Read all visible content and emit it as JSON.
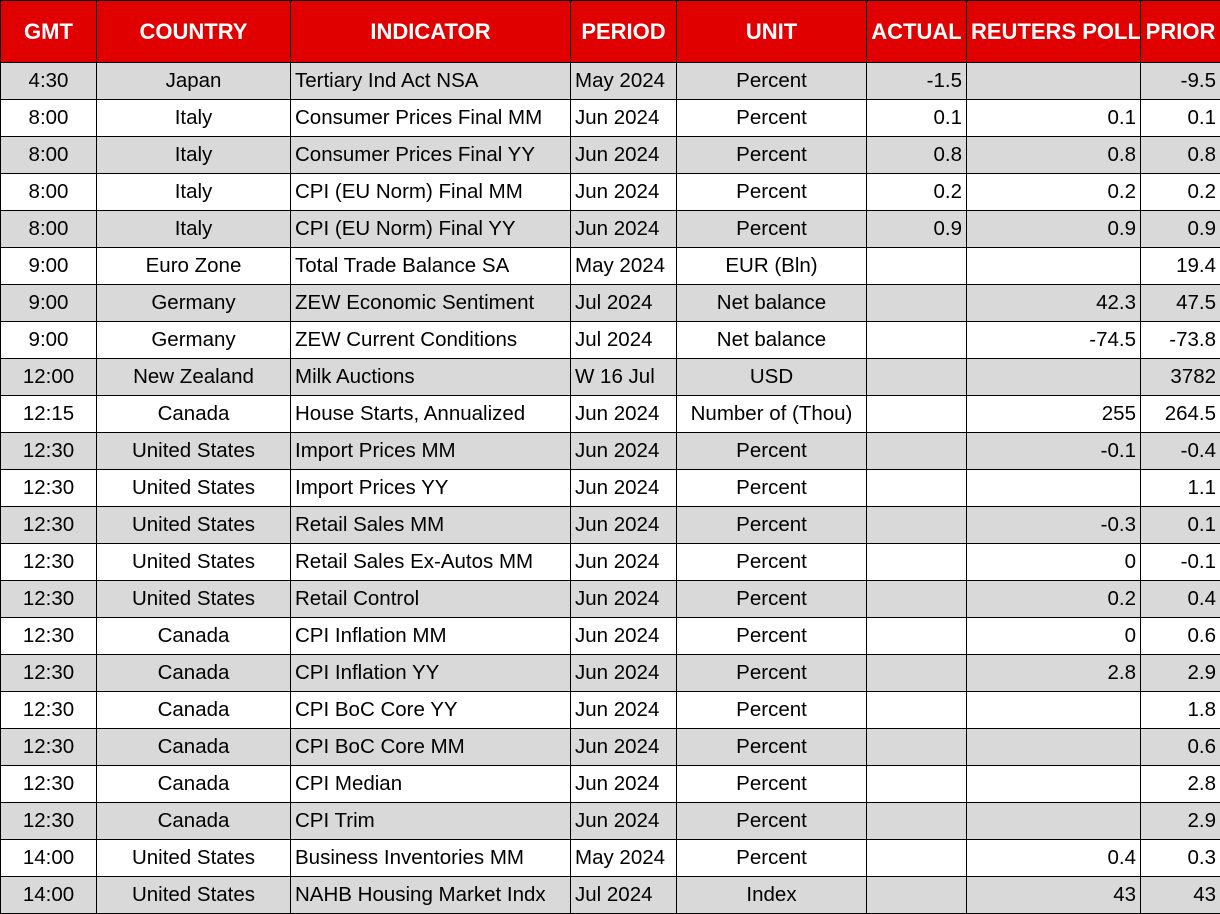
{
  "colors": {
    "header_bg": "#e00000",
    "header_text": "#ffffff",
    "stripe": "#d9d9d9"
  },
  "headers": [
    "GMT",
    "COUNTRY",
    "INDICATOR",
    "PERIOD",
    "UNIT",
    "ACTUAL",
    "REUTERS POLL",
    "PRIOR"
  ],
  "rows": [
    [
      "4:30",
      "Japan",
      "Tertiary Ind Act NSA",
      "May 2024",
      "Percent",
      "-1.5",
      "",
      "-9.5"
    ],
    [
      "8:00",
      "Italy",
      "Consumer Prices Final MM",
      "Jun 2024",
      "Percent",
      "0.1",
      "0.1",
      "0.1"
    ],
    [
      "8:00",
      "Italy",
      "Consumer Prices Final YY",
      "Jun 2024",
      "Percent",
      "0.8",
      "0.8",
      "0.8"
    ],
    [
      "8:00",
      "Italy",
      "CPI (EU Norm) Final MM",
      "Jun 2024",
      "Percent",
      "0.2",
      "0.2",
      "0.2"
    ],
    [
      "8:00",
      "Italy",
      "CPI (EU Norm) Final YY",
      "Jun 2024",
      "Percent",
      "0.9",
      "0.9",
      "0.9"
    ],
    [
      "9:00",
      "Euro Zone",
      "Total Trade Balance SA",
      "May 2024",
      "EUR (Bln)",
      "",
      "",
      "19.4"
    ],
    [
      "9:00",
      "Germany",
      "ZEW Economic Sentiment",
      "Jul 2024",
      "Net balance",
      "",
      "42.3",
      "47.5"
    ],
    [
      "9:00",
      "Germany",
      "ZEW Current Conditions",
      "Jul 2024",
      "Net balance",
      "",
      "-74.5",
      "-73.8"
    ],
    [
      "12:00",
      "New Zealand",
      "Milk Auctions",
      "W 16 Jul",
      "USD",
      "",
      "",
      "3782"
    ],
    [
      "12:15",
      "Canada",
      "House Starts, Annualized",
      "Jun 2024",
      "Number of (Thou)",
      "",
      "255",
      "264.5"
    ],
    [
      "12:30",
      "United States",
      "Import Prices MM",
      "Jun 2024",
      "Percent",
      "",
      "-0.1",
      "-0.4"
    ],
    [
      "12:30",
      "United States",
      "Import Prices YY",
      "Jun 2024",
      "Percent",
      "",
      "",
      "1.1"
    ],
    [
      "12:30",
      "United States",
      "Retail Sales MM",
      "Jun 2024",
      "Percent",
      "",
      "-0.3",
      "0.1"
    ],
    [
      "12:30",
      "United States",
      "Retail Sales Ex-Autos MM",
      "Jun 2024",
      "Percent",
      "",
      "0",
      "-0.1"
    ],
    [
      "12:30",
      "United States",
      "Retail Control",
      "Jun 2024",
      "Percent",
      "",
      "0.2",
      "0.4"
    ],
    [
      "12:30",
      "Canada",
      "CPI Inflation MM",
      "Jun 2024",
      "Percent",
      "",
      "0",
      "0.6"
    ],
    [
      "12:30",
      "Canada",
      "CPI Inflation YY",
      "Jun 2024",
      "Percent",
      "",
      "2.8",
      "2.9"
    ],
    [
      "12:30",
      "Canada",
      "CPI BoC Core YY",
      "Jun 2024",
      "Percent",
      "",
      "",
      "1.8"
    ],
    [
      "12:30",
      "Canada",
      "CPI BoC Core MM",
      "Jun 2024",
      "Percent",
      "",
      "",
      "0.6"
    ],
    [
      "12:30",
      "Canada",
      "CPI Median",
      "Jun 2024",
      "Percent",
      "",
      "",
      "2.8"
    ],
    [
      "12:30",
      "Canada",
      "CPI Trim",
      "Jun 2024",
      "Percent",
      "",
      "",
      "2.9"
    ],
    [
      "14:00",
      "United States",
      "Business Inventories MM",
      "May 2024",
      "Percent",
      "",
      "0.4",
      "0.3"
    ],
    [
      "14:00",
      "United States",
      "NAHB Housing Market Indx",
      "Jul 2024",
      "Index",
      "",
      "43",
      "43"
    ]
  ]
}
